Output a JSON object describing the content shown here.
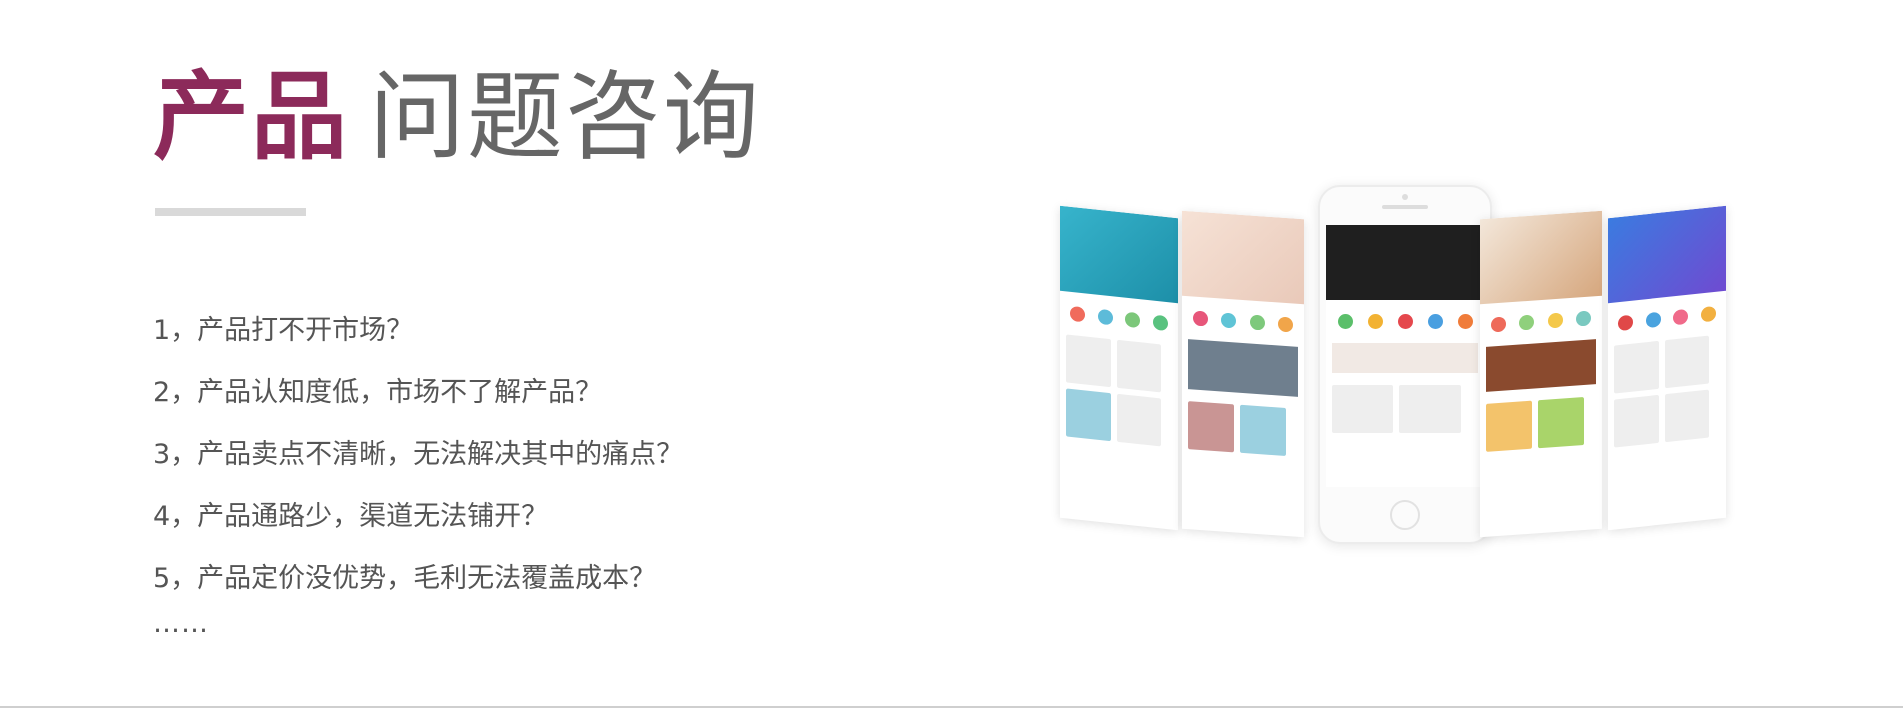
{
  "title": {
    "accent": "产品",
    "rest": "问题咨询"
  },
  "questions": [
    "1，产品打不开市场？",
    "2，产品认知度低，市场不了解产品？",
    "3，产品卖点不清晰，无法解决其中的痛点？",
    "4，产品通路少，渠道无法铺开？",
    "5，产品定价没优势，毛利无法覆盖成本？"
  ],
  "ellipsis": "……",
  "colors": {
    "accent": "#8c2a5a",
    "title_gray": "#666666",
    "text": "#555555",
    "divider": "#d9d9d9"
  }
}
